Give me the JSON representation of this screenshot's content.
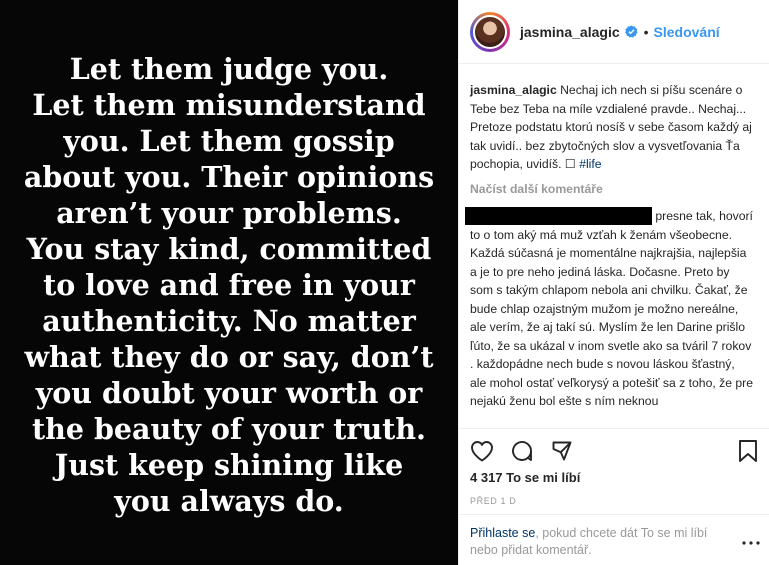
{
  "image": {
    "quote_lines": [
      "Let them judge you.",
      "Let them misunderstand",
      "you. Let them gossip",
      "about you. Their opinions",
      "aren’t your problems.",
      "You stay kind, committed",
      "to love and free in your",
      "authenticity. No matter",
      "what they do or say, don’t",
      "you doubt your worth or",
      "the beauty of your truth.",
      "Just keep shining like",
      "you always do."
    ]
  },
  "header": {
    "username": "jasmina_alagic",
    "dot": "•",
    "follow_label": "Sledování"
  },
  "caption": {
    "username": "jasmina_alagic",
    "text": "Nechaj ich nech si píšu scenáre o Tebe bez Teba na míle vzdialené pravde.. Nechaj... Pretoze podstatu ktorú nosíš v sebe časom každý aj tak uvidí.. bez zbytočných slov a vysvetľovania Ťa pochopia, uvidíš. ",
    "symbol": "☐",
    "hashtag": "#life"
  },
  "load_more": "Načíst další komentáře",
  "comment": {
    "text": "presne tak, hovorí to o tom aký má muž vzťah k ženám všeobecne. Každá súčasná je momentálne najkrajšia, najlepšia a je to pre neho jediná láska. Dočasne. Preto by som s takým chlapom nebola ani chvilku. Čakať, že bude chlap ozajstným mužom je možno nereálne, ale verím, že aj takí sú. Myslím že len Darine prišlo ľúto, že sa ukázal v inom svetle ako sa tváril 7 rokov . každopádne nech bude s novou láskou šťastný, ale mohol ostať veľkorysý a potešiť sa z toho, že pre nejakú ženu bol ešte s ním neknou"
  },
  "likes_text": "4 317 To se mi líbí",
  "time_text": "PŘED 1 D",
  "footer": {
    "login_link": "Přihlaste se",
    "rest": ", pokud chcete dát To se mi líbí nebo přidat komentář."
  },
  "icons": [
    "heart-icon",
    "comment-icon",
    "share-icon",
    "bookmark-icon",
    "more-options-icon",
    "verified-badge-icon"
  ]
}
